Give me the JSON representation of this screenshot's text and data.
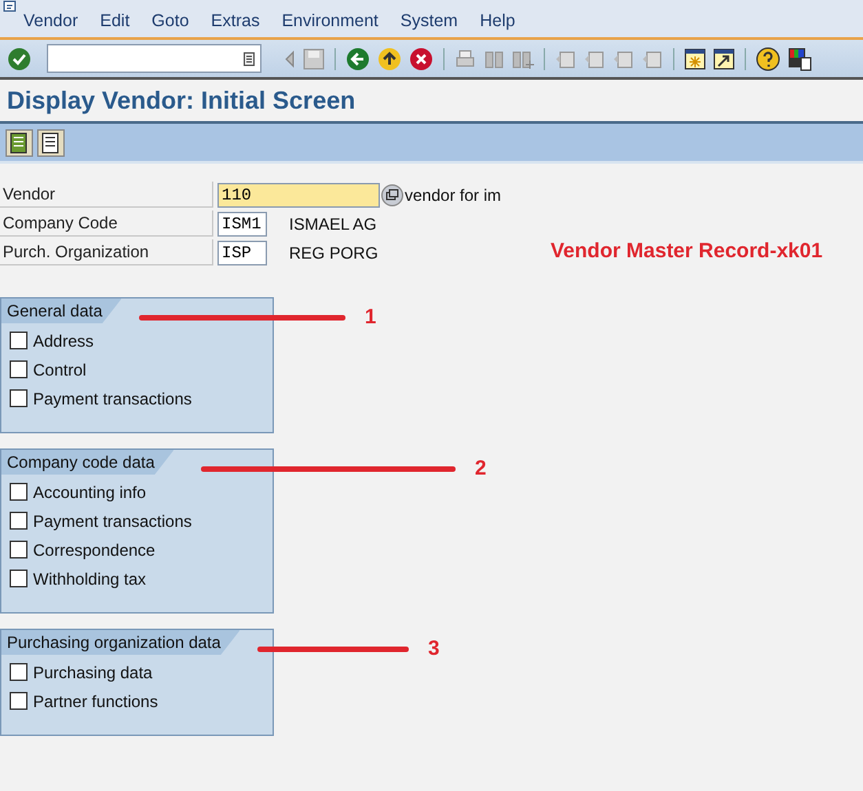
{
  "menu": [
    {
      "label": "Vendor"
    },
    {
      "label": "Edit"
    },
    {
      "label": "Goto"
    },
    {
      "label": "Extras"
    },
    {
      "label": "Environment"
    },
    {
      "label": "System"
    },
    {
      "label": "Help"
    }
  ],
  "title": "Display Vendor:  Initial Screen",
  "fields": [
    {
      "label": "Vendor",
      "value": "110",
      "description": "vendor for im",
      "kind": "required"
    },
    {
      "label": "Company Code",
      "value": "ISM1",
      "description": "ISMAEL AG",
      "kind": "plain"
    },
    {
      "label": "Purch. Organization",
      "value": "ISP",
      "description": "REG PORG",
      "kind": "plain"
    }
  ],
  "annotation_title": "Vendor Master Record-xk01",
  "groups": [
    {
      "title": "General data",
      "marker": "1",
      "items": [
        {
          "label": "Address",
          "checked": false
        },
        {
          "label": "Control",
          "checked": false
        },
        {
          "label": "Payment transactions",
          "checked": false
        }
      ]
    },
    {
      "title": "Company code data",
      "marker": "2",
      "items": [
        {
          "label": "Accounting info",
          "checked": false
        },
        {
          "label": "Payment transactions",
          "checked": false
        },
        {
          "label": "Correspondence",
          "checked": false
        },
        {
          "label": "Withholding tax",
          "checked": false
        }
      ]
    },
    {
      "title": "Purchasing organization data",
      "marker": "3",
      "items": [
        {
          "label": "Purchasing data",
          "checked": false
        },
        {
          "label": "Partner functions",
          "checked": false
        }
      ]
    }
  ]
}
